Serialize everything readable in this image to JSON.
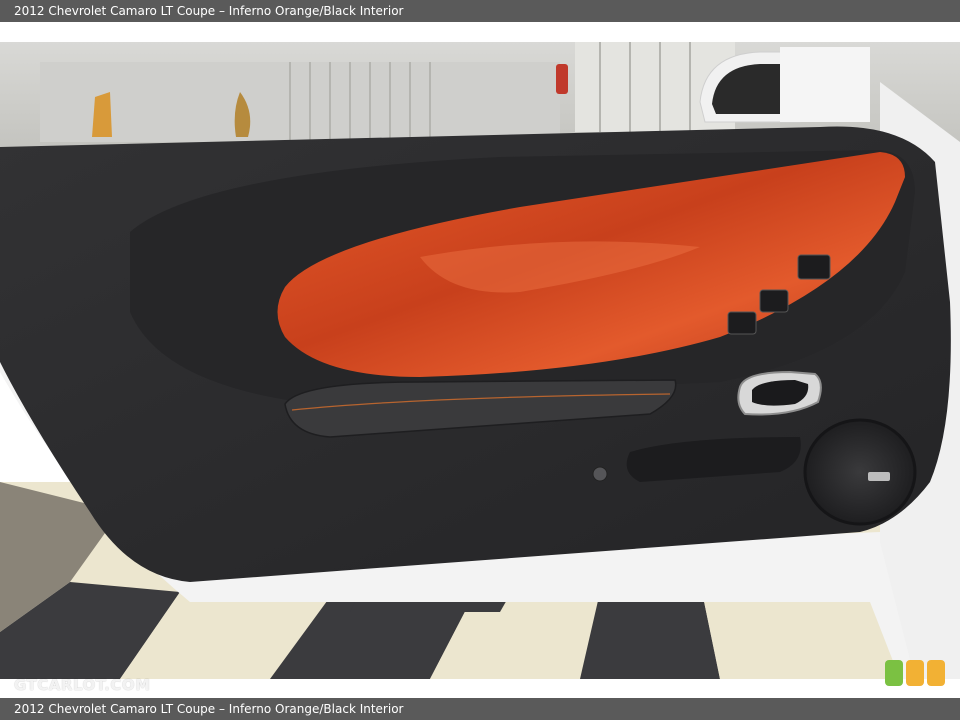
{
  "caption": {
    "top": "2012 Chevrolet Camaro LT Coupe – Inferno Orange/Black Interior",
    "bottom": "2012 Chevrolet Camaro LT Coupe – Inferno Orange/Black Interior"
  },
  "watermark": "GTCARLOT.COM",
  "photo": {
    "subject": "car-door-interior-panel",
    "colors": {
      "orange_insert": "#d4471f",
      "panel_black": "#2b2b2d",
      "floor_light": "#ece6cf",
      "floor_dark": "#3b3b3e",
      "body_white": "#f3f3f3"
    }
  },
  "badge_dots": [
    "#7bc142",
    "#f2b134",
    "#f2b134"
  ]
}
